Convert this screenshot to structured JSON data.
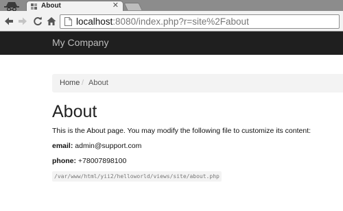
{
  "browser": {
    "tab": {
      "title": "About",
      "favicon": "yii-favicon-icon",
      "close_icon": "close-icon"
    },
    "address_bar": {
      "url_host": "localhost",
      "url_rest": ":8080/index.php?r=site%2Fabout",
      "page_icon": "page-icon"
    },
    "nav_icons": [
      "back-arrow-icon",
      "forward-arrow-icon",
      "reload-icon",
      "home-icon"
    ],
    "incognito_icon": "incognito-icon"
  },
  "page": {
    "brand": "My Company",
    "breadcrumb": {
      "home": "Home",
      "separator": "/",
      "current": "About"
    },
    "title": "About",
    "intro": "This is the About page. You may modify the following file to customize its content:",
    "email": {
      "label": "email:",
      "value": "admin@support.com"
    },
    "phone": {
      "label": "phone:",
      "value": "+78007898100"
    },
    "file_path": "/var/www/html/yii2/helloworld/views/site/about.php"
  },
  "colors": {
    "navbar_bg": "#1f1f1f",
    "brand_text": "#bdbdbd",
    "breadcrumb_bg": "#f3f3f3",
    "tabstrip_bg": "#8c8c8c"
  }
}
